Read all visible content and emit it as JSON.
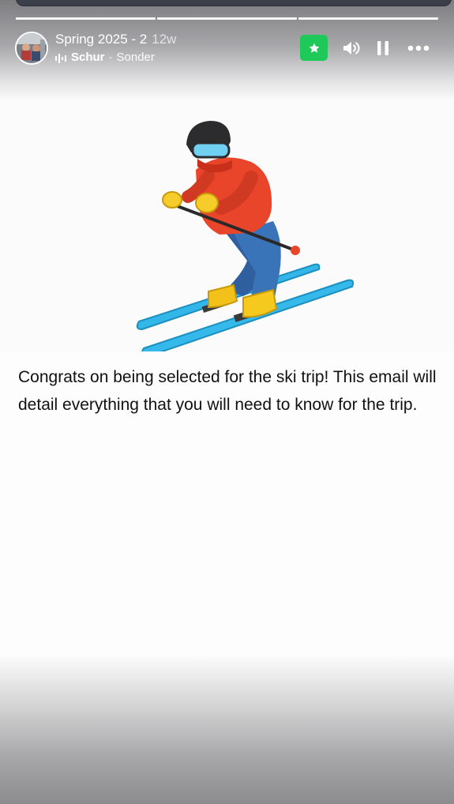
{
  "story": {
    "title": "Spring 2025 - 2",
    "age": "12w",
    "music": {
      "artist": "Schur",
      "separator": "·",
      "track": "Sonder",
      "icon": "sound-wave-icon"
    },
    "progress": {
      "segments_total": 3,
      "segments_done": 3
    },
    "controls": {
      "close_friends_icon": "star-icon",
      "close_friends_color": "#1ec95a",
      "mute_icon": "speaker-icon",
      "pause_icon": "pause-icon",
      "more_icon": "more-horizontal-icon"
    }
  },
  "content": {
    "emoji": "person-skiing-emoji",
    "message": "Congrats on being selected for the ski trip! This email will detail everything that you will need to know for the trip."
  }
}
